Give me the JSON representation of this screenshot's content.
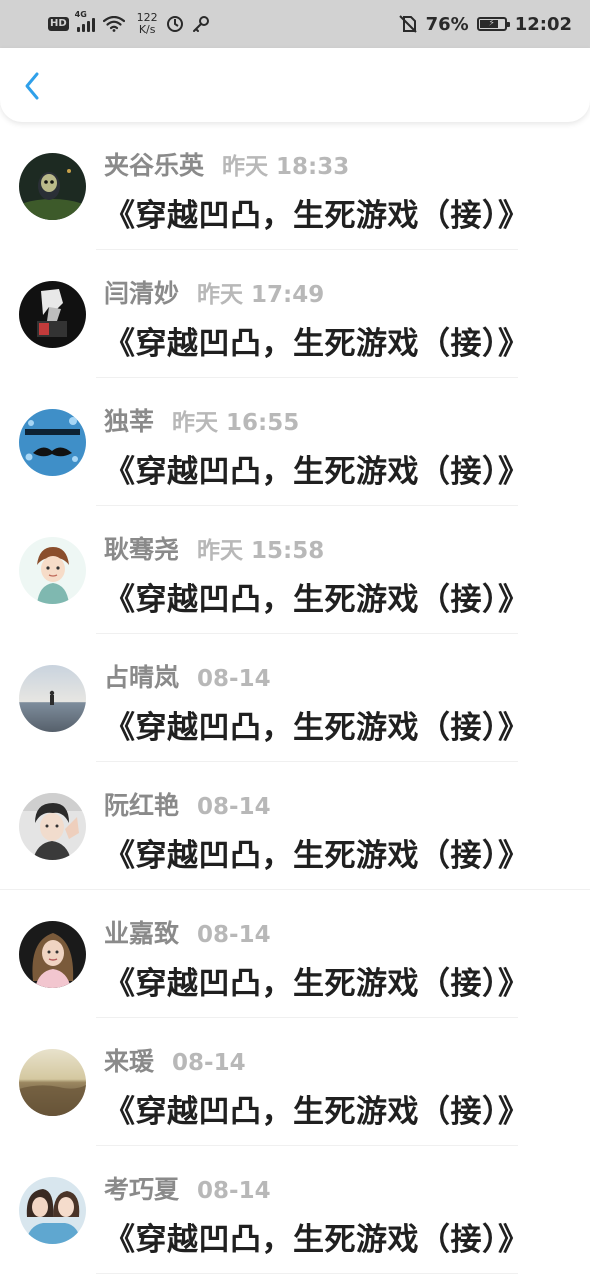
{
  "status_bar": {
    "hd": "HD",
    "network": "4G",
    "speed_value": "122",
    "speed_unit": "K/s",
    "battery_percent": "76%",
    "battery_level": 0.76,
    "time": "12:02",
    "icons": [
      "hd-icon",
      "signal-icon",
      "wifi-icon",
      "speed-icon",
      "data-saver-icon",
      "key-icon",
      "no-sim-icon",
      "battery-icon"
    ]
  },
  "header": {
    "back_icon": "chevron-left-icon",
    "accent_color": "#2fa0ea"
  },
  "messages": [
    {
      "name": "夹谷乐英",
      "time": "昨天 18:33",
      "text": "《穿越凹凸，生死游戏（接）》"
    },
    {
      "name": "闫清妙",
      "time": "昨天 17:49",
      "text": "《穿越凹凸，生死游戏（接）》"
    },
    {
      "name": "独莘",
      "time": "昨天 16:55",
      "text": "《穿越凹凸，生死游戏（接）》"
    },
    {
      "name": "耿骞尧",
      "time": "昨天 15:58",
      "text": "《穿越凹凸，生死游戏（接）》"
    },
    {
      "name": "占晴岚",
      "time": "08-14",
      "text": "《穿越凹凸，生死游戏（接）》"
    },
    {
      "name": "阮红艳",
      "time": "08-14",
      "text": "《穿越凹凸，生死游戏（接）》"
    },
    {
      "name": "业嘉致",
      "time": "08-14",
      "text": "《穿越凹凸，生死游戏（接）》"
    },
    {
      "name": "来瑗",
      "time": "08-14",
      "text": "《穿越凹凸，生死游戏（接）》"
    },
    {
      "name": "考巧夏",
      "time": "08-14",
      "text": "《穿越凹凸，生死游戏（接）》"
    }
  ]
}
